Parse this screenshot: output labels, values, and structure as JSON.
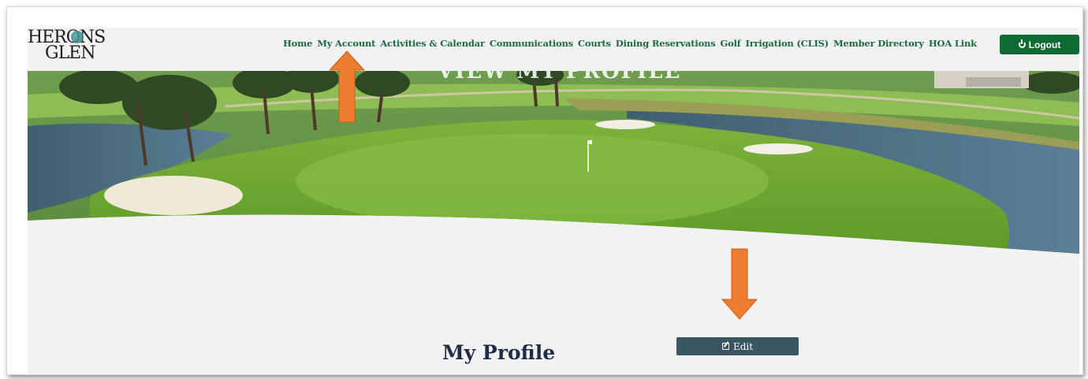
{
  "header": {
    "logo_line1": "HERONS",
    "logo_line2": "GLEN",
    "nav": [
      {
        "label": "Home"
      },
      {
        "label": "My Account"
      },
      {
        "label": "Activities & Calendar"
      },
      {
        "label": "Communications"
      },
      {
        "label": "Courts"
      },
      {
        "label": "Dining Reservations"
      },
      {
        "label": "Golf"
      },
      {
        "label": "Irrigation (CLIS)"
      },
      {
        "label": "Member Directory"
      },
      {
        "label": "HOA Link"
      }
    ],
    "logout_label": "Logout",
    "logout_icon": "power-icon",
    "brand_green": "#0e6b32",
    "nav_color": "#1d6b3f"
  },
  "banner": {
    "title": "VIEW MY PROFILE",
    "image": "golf-course-green-with-pond-and-bunkers"
  },
  "main": {
    "page_title": "My Profile",
    "edit_label": "Edit",
    "edit_icon": "edit-icon"
  },
  "annotations": {
    "arrow_color": "#ed7d31",
    "arrows": [
      "up-arrow-at-my-account",
      "down-arrow-at-edit"
    ]
  }
}
